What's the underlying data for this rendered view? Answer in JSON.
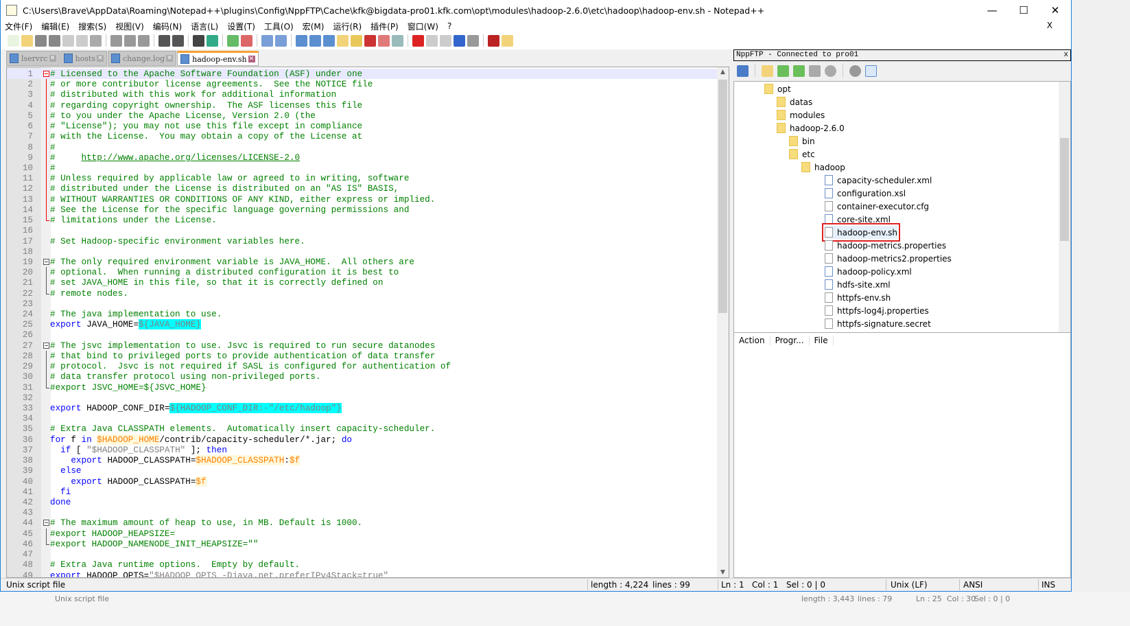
{
  "window": {
    "title": "C:\\Users\\Brave\\AppData\\Roaming\\Notepad++\\plugins\\Config\\NppFTP\\Cache\\kfk@bigdata-pro01.kfk.com\\opt\\modules\\hadoop-2.6.0\\etc\\hadoop\\hadoop-env.sh - Notepad++",
    "minimize": "—",
    "maximize": "☐",
    "close": "✕"
  },
  "menu": [
    "文件(F)",
    "编辑(E)",
    "搜索(S)",
    "视图(V)",
    "编码(N)",
    "语言(L)",
    "设置(T)",
    "工具(O)",
    "宏(M)",
    "运行(R)",
    "插件(P)",
    "窗口(W)",
    "?"
  ],
  "menu_close": "X",
  "toolbar": [
    "new",
    "open",
    "save",
    "save-all",
    "close",
    "close-all",
    "print",
    "cut",
    "copy",
    "paste",
    "undo",
    "redo",
    "find",
    "replace",
    "zoom-in",
    "zoom-out",
    "sync-v",
    "sync-h",
    "word-wrap",
    "show-all",
    "indent-guide",
    "udl",
    "doc-map",
    "function-list",
    "folder-workspace",
    "monitor",
    "record",
    "stop",
    "play",
    "play-multi",
    "save-macro",
    "spell-check",
    "spell-auto"
  ],
  "tabs": [
    {
      "label": "lservrc",
      "active": false
    },
    {
      "label": "hosts",
      "active": false
    },
    {
      "label": "change.log",
      "active": false
    },
    {
      "label": "hadoop-env.sh",
      "active": true
    }
  ],
  "editor": {
    "current_line": 1,
    "lines": [
      [
        [
          "c",
          "# Licensed to the Apache Software Foundation (ASF) under one"
        ]
      ],
      [
        [
          "c",
          "# or more contributor license agreements.  See the NOTICE file"
        ]
      ],
      [
        [
          "c",
          "# distributed with this work for additional information"
        ]
      ],
      [
        [
          "c",
          "# regarding copyright ownership.  The ASF licenses this file"
        ]
      ],
      [
        [
          "c",
          "# to you under the Apache License, Version 2.0 (the"
        ]
      ],
      [
        [
          "c",
          "# \"License\"); you may not use this file except in compliance"
        ]
      ],
      [
        [
          "c",
          "# with the License.  You may obtain a copy of the License at"
        ]
      ],
      [
        [
          "c",
          "#"
        ]
      ],
      [
        [
          "c",
          "#     "
        ],
        [
          "u",
          "http://www.apache.org/licenses/LICENSE-2.0"
        ]
      ],
      [
        [
          "c",
          "#"
        ]
      ],
      [
        [
          "c",
          "# Unless required by applicable law or agreed to in writing, software"
        ]
      ],
      [
        [
          "c",
          "# distributed under the License is distributed on an \"AS IS\" BASIS,"
        ]
      ],
      [
        [
          "c",
          "# WITHOUT WARRANTIES OR CONDITIONS OF ANY KIND, either express or implied."
        ]
      ],
      [
        [
          "c",
          "# See the License for the specific language governing permissions and"
        ]
      ],
      [
        [
          "c",
          "# limitations under the License."
        ]
      ],
      [],
      [
        [
          "c",
          "# Set Hadoop-specific environment variables here."
        ]
      ],
      [],
      [
        [
          "c",
          "# The only required environment variable is JAVA_HOME.  All others are"
        ]
      ],
      [
        [
          "c",
          "# optional.  When running a distributed configuration it is best to"
        ]
      ],
      [
        [
          "c",
          "# set JAVA_HOME in this file, so that it is correctly defined on"
        ]
      ],
      [
        [
          "c",
          "# remote nodes."
        ]
      ],
      [],
      [
        [
          "c",
          "# The java implementation to use."
        ]
      ],
      [
        [
          "k",
          "export"
        ],
        [
          "t",
          " JAVA_HOME="
        ],
        [
          "h",
          "${JAVA_HOME}"
        ]
      ],
      [],
      [
        [
          "c",
          "# The jsvc implementation to use. Jsvc is required to run secure datanodes"
        ]
      ],
      [
        [
          "c",
          "# that bind to privileged ports to provide authentication of data transfer"
        ]
      ],
      [
        [
          "c",
          "# protocol.  Jsvc is not required if SASL is configured for authentication of"
        ]
      ],
      [
        [
          "c",
          "# data transfer protocol using non-privileged ports."
        ]
      ],
      [
        [
          "c",
          "#export JSVC_HOME=${JSVC_HOME}"
        ]
      ],
      [],
      [
        [
          "k",
          "export"
        ],
        [
          "t",
          " HADOOP_CONF_DIR="
        ],
        [
          "h",
          "${HADOOP_CONF_DIR:-\"/etc/hadoop\"}"
        ]
      ],
      [],
      [
        [
          "c",
          "# Extra Java CLASSPATH elements.  Automatically insert capacity-scheduler."
        ]
      ],
      [
        [
          "k",
          "for"
        ],
        [
          "t",
          " f "
        ],
        [
          "k",
          "in"
        ],
        [
          "t",
          " "
        ],
        [
          "v",
          "$HADOOP_HOME"
        ],
        [
          "t",
          "/contrib/capacity-scheduler/*.jar; "
        ],
        [
          "k",
          "do"
        ]
      ],
      [
        [
          "t",
          "  "
        ],
        [
          "k",
          "if"
        ],
        [
          "t",
          " [ "
        ],
        [
          "s",
          "\"$HADOOP_CLASSPATH\""
        ],
        [
          "t",
          " ]; "
        ],
        [
          "k",
          "then"
        ]
      ],
      [
        [
          "t",
          "    "
        ],
        [
          "k",
          "export"
        ],
        [
          "t",
          " HADOOP_CLASSPATH="
        ],
        [
          "v",
          "$HADOOP_CLASSPATH"
        ],
        [
          "t",
          ":"
        ],
        [
          "v",
          "$f"
        ]
      ],
      [
        [
          "t",
          "  "
        ],
        [
          "k",
          "else"
        ]
      ],
      [
        [
          "t",
          "    "
        ],
        [
          "k",
          "export"
        ],
        [
          "t",
          " HADOOP_CLASSPATH="
        ],
        [
          "v",
          "$f"
        ]
      ],
      [
        [
          "t",
          "  "
        ],
        [
          "k",
          "fi"
        ]
      ],
      [
        [
          "k",
          "done"
        ]
      ],
      [],
      [
        [
          "c",
          "# The maximum amount of heap to use, in MB. Default is 1000."
        ]
      ],
      [
        [
          "c",
          "#export HADOOP_HEAPSIZE="
        ]
      ],
      [
        [
          "c",
          "#export HADOOP_NAMENODE_INIT_HEAPSIZE=\"\""
        ]
      ],
      [],
      [
        [
          "c",
          "# Extra Java runtime options.  Empty by default."
        ]
      ],
      [
        [
          "k",
          "export"
        ],
        [
          "t",
          " HADOOP_OPTS="
        ],
        [
          "s",
          "\"$HADOOP_OPTS -Djava.net.preferIPv4Stack=true\""
        ]
      ]
    ]
  },
  "nppftp": {
    "title": "NppFTP - Connected to pro01",
    "close": "x",
    "tree": [
      {
        "label": "opt",
        "type": "folder",
        "depth": 0
      },
      {
        "label": "datas",
        "type": "folder",
        "depth": 1
      },
      {
        "label": "modules",
        "type": "folder",
        "depth": 1
      },
      {
        "label": "hadoop-2.6.0",
        "type": "folder",
        "depth": 2
      },
      {
        "label": "bin",
        "type": "folder",
        "depth": 3
      },
      {
        "label": "etc",
        "type": "folder",
        "depth": 3
      },
      {
        "label": "hadoop",
        "type": "folder",
        "depth": 4
      },
      {
        "label": "capacity-scheduler.xml",
        "type": "xml",
        "depth": 5
      },
      {
        "label": "configuration.xsl",
        "type": "xsl",
        "depth": 5
      },
      {
        "label": "container-executor.cfg",
        "type": "file",
        "depth": 5
      },
      {
        "label": "core-site.xml",
        "type": "xml",
        "depth": 5
      },
      {
        "label": "hadoop-env.sh",
        "type": "file",
        "depth": 5,
        "selected": true
      },
      {
        "label": "hadoop-metrics.properties",
        "type": "file",
        "depth": 5
      },
      {
        "label": "hadoop-metrics2.properties",
        "type": "file",
        "depth": 5
      },
      {
        "label": "hadoop-policy.xml",
        "type": "xml",
        "depth": 5
      },
      {
        "label": "hdfs-site.xml",
        "type": "xml",
        "depth": 5
      },
      {
        "label": "httpfs-env.sh",
        "type": "file",
        "depth": 5
      },
      {
        "label": "httpfs-log4j.properties",
        "type": "file",
        "depth": 5
      },
      {
        "label": "httpfs-signature.secret",
        "type": "file",
        "depth": 5
      }
    ],
    "queue_headers": [
      "Action",
      "Progr...",
      "File"
    ]
  },
  "status": {
    "file_type": "Unix script file",
    "length": "length : 4,224",
    "lines": "lines : 99",
    "ln": "Ln : 1",
    "col": "Col : 1",
    "sel": "Sel : 0 | 0",
    "eol": "Unix (LF)",
    "encoding": "ANSI",
    "mode": "INS"
  },
  "behind_status": {
    "file_type": "Unix script file",
    "length": "length : 3,443",
    "lines": "lines : 79",
    "ln": "Ln : 25",
    "col": "Col : 30",
    "sel": "Sel : 0 | 0"
  }
}
